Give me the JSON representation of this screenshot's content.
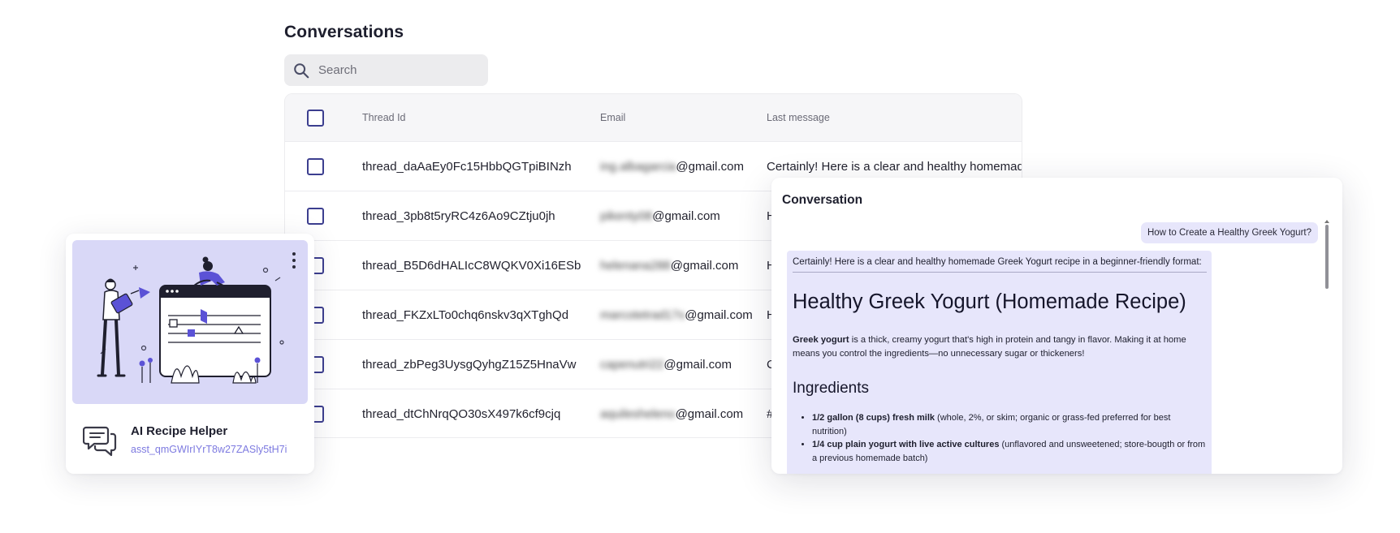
{
  "conversations": {
    "title": "Conversations",
    "search_placeholder": "Search",
    "columns": {
      "thread_id": "Thread Id",
      "email": "Email",
      "last_message": "Last message"
    },
    "rows": [
      {
        "thread_id": "thread_daAaEy0Fc15HbbQGTpiBINzh",
        "email_local": "ing.albagarcia",
        "email_domain": "@gmail.com",
        "last_message": "Certainly! Here is a clear and healthy homemade"
      },
      {
        "thread_id": "thread_3pb8t5ryRC4z6Ao9CZtju0jh",
        "email_local": "pikenty08",
        "email_domain": "@gmail.com",
        "last_message": "H"
      },
      {
        "thread_id": "thread_B5D6dHALIcC8WQKV0Xi16ESb",
        "email_local": "helenana288",
        "email_domain": "@gmail.com",
        "last_message": "H"
      },
      {
        "thread_id": "thread_FKZxLTo0chq6nskv3qXTghQd",
        "email_local": "marcotetrad17s",
        "email_domain": "@gmail.com",
        "last_message": "H"
      },
      {
        "thread_id": "thread_zbPeg3UysgQyhgZ15Z5HnaVw",
        "email_local": "capenutri22",
        "email_domain": "@gmail.com",
        "last_message": "C"
      },
      {
        "thread_id": "thread_dtChNrqQO30sX497k6cf9cjq",
        "email_local": "aquilesheleno",
        "email_domain": "@gmail.com",
        "last_message": "#"
      }
    ]
  },
  "assistant": {
    "name": "AI Recipe Helper",
    "id": "asst_qmGWIrIYrT8w27ZASly5tH7i",
    "icon": "chat-bubbles-icon",
    "illustration_colors": {
      "background": "#d9d8f7",
      "accent": "#5b52d6"
    }
  },
  "conversation_panel": {
    "title": "Conversation",
    "user_message": "How to Create a Healthy Greek Yogurt?",
    "ai_intro": "Certainly! Here is a clear and healthy homemade Greek Yogurt recipe in a beginner-friendly format:",
    "ai_heading": "Healthy Greek Yogurt (Homemade Recipe)",
    "ai_para_bold": "Greek yogurt",
    "ai_para_rest": " is a thick, creamy yogurt that's high in protein and tangy in flavor. Making it at home means you control the ingredients—no unnecessary sugar or thickeners!",
    "ai_subheading": "Ingredients",
    "ingredients": [
      {
        "bold": "1/2 gallon (8 cups) fresh milk",
        "rest": " (whole, 2%, or skim; organic or grass-fed preferred for best nutrition)"
      },
      {
        "bold": "1/4 cup plain yogurt with live active cultures",
        "rest": " (unflavored and unsweetened; store-bougth or from a previous homemade batch)"
      }
    ]
  },
  "colors": {
    "accent": "#5b52d6",
    "checkbox_border": "#3c3e8f",
    "bubble_bg": "#e7e6fb",
    "assistant_id": "#7d7ae0"
  }
}
